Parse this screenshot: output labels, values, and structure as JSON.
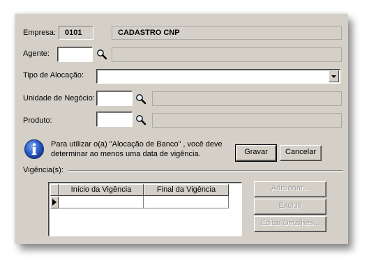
{
  "form": {
    "empresa_label": "Empresa:",
    "empresa_code": "0101",
    "empresa_name": "CADASTRO CNP",
    "agente_label": "Agente:",
    "agente_value": "",
    "agente_desc": "",
    "tipo_alocacao_label": "Tipo de Alocação:",
    "tipo_alocacao_value": "",
    "unidade_label": "Unidade de Negócio:",
    "unidade_value": "",
    "unidade_desc": "",
    "produto_label": "Produto:",
    "produto_value": "",
    "produto_desc": ""
  },
  "info": {
    "line1": "Para utilizar o(a) \"Alocação de Banco\" , você deve",
    "line2": "determinar ao menos uma data de vigência."
  },
  "buttons": {
    "gravar": "Gravar",
    "cancelar": "Cancelar",
    "adicionar": "Adicionar...",
    "excluir": "Excluir",
    "editar": "Editar/Detalhes..."
  },
  "vigencias": {
    "group_label": "Vigência(s):",
    "columns": [
      "Início da Vigência",
      "Final da Vigência"
    ]
  },
  "icons": {
    "search": "magnifier-icon",
    "info": "info-icon",
    "dropdown": "chevron-down-icon",
    "row_pointer": "triangle-right-icon"
  },
  "colors": {
    "panel_bg": "#d4d0c8",
    "info_blue": "#1f4fb8"
  }
}
